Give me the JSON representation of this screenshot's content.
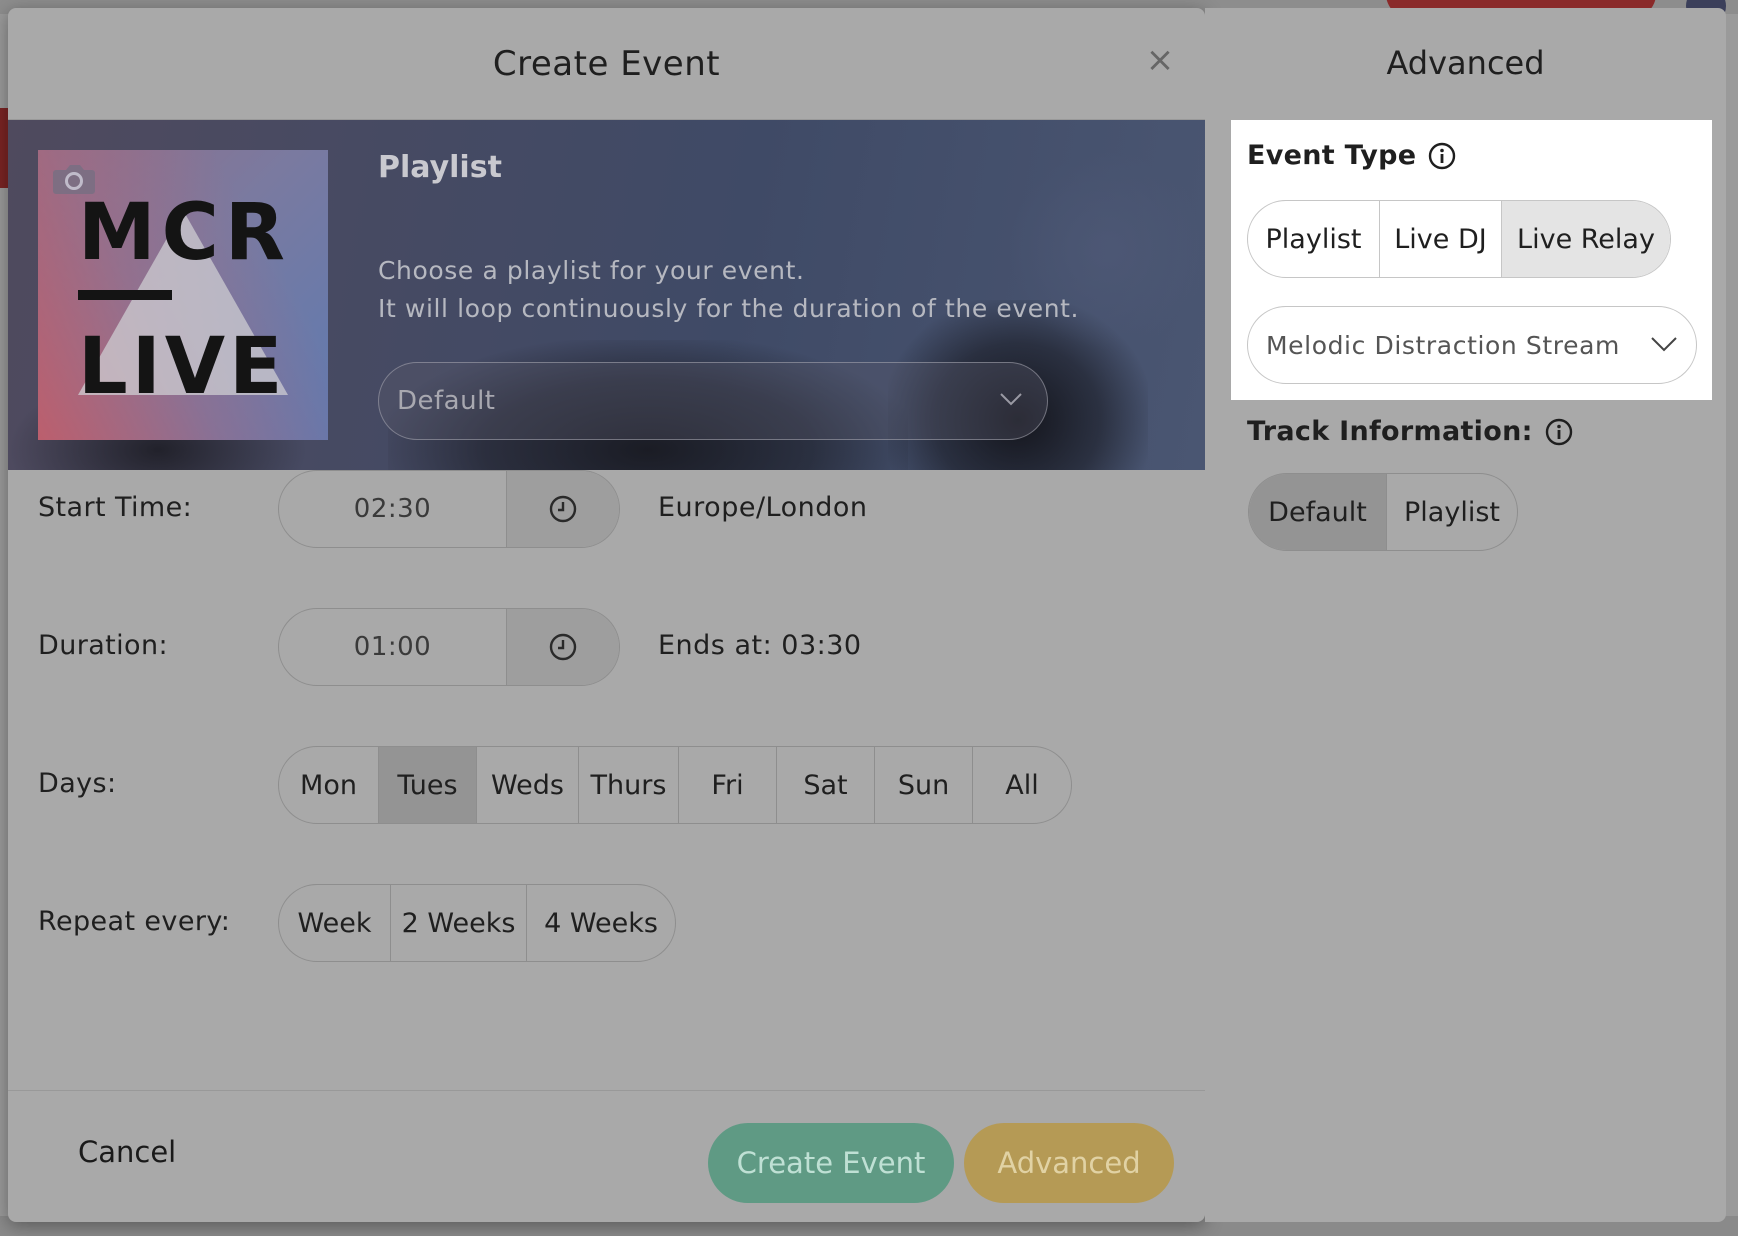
{
  "modal": {
    "title": "Create Event",
    "close_label": "×"
  },
  "playlist_panel": {
    "heading": "Playlist",
    "description_line1": "Choose a playlist for your event.",
    "description_line2": "It will loop continuously for the duration of the event.",
    "playlist_select_value": "Default",
    "cover_title_top": "MCR",
    "cover_title_bottom": "LIVE"
  },
  "form": {
    "start_time": {
      "label": "Start Time:",
      "value": "02:30",
      "timezone": "Europe/London"
    },
    "duration": {
      "label": "Duration:",
      "value": "01:00",
      "ends_at": "Ends at: 03:30"
    },
    "days": {
      "label": "Days:",
      "options": [
        "Mon",
        "Tues",
        "Weds",
        "Thurs",
        "Fri",
        "Sat",
        "Sun",
        "All"
      ],
      "selected": "Tues"
    },
    "repeat": {
      "label": "Repeat every:",
      "options": [
        "Week",
        "2 Weeks",
        "4 Weeks"
      ]
    }
  },
  "footer": {
    "cancel_label": "Cancel",
    "create_label": "Create Event",
    "advanced_label": "Advanced"
  },
  "advanced_panel": {
    "title": "Advanced",
    "event_type": {
      "label": "Event Type",
      "options": [
        "Playlist",
        "Live DJ",
        "Live Relay"
      ],
      "selected": "Live Relay"
    },
    "relay_select_value": "Melodic Distraction Stream",
    "track_information": {
      "label": "Track Information:",
      "options": [
        "Default",
        "Playlist"
      ],
      "selected": "Default"
    }
  },
  "colors": {
    "create_button": "#5f9a84",
    "advanced_button": "#b59a55",
    "overlay_gray": "#a9a9a9",
    "highlight": "#ffffff"
  },
  "icons": {
    "close": "close-icon",
    "camera": "camera-icon",
    "clock": "clock-icon",
    "chevron": "chevron-down-icon",
    "info": "info-icon"
  }
}
